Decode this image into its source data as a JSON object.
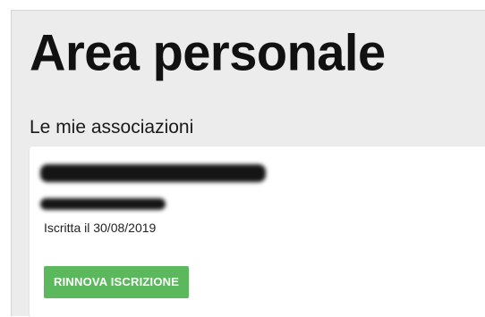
{
  "page": {
    "title": "Area personale",
    "section_title": "Le mie associazioni"
  },
  "association_card": {
    "name_redacted": true,
    "subtitle_redacted": true,
    "joined_text": "Iscritta il 30/08/2019",
    "renew_button_label": "RINNOVA ISCRIZIONE"
  },
  "colors": {
    "background": "#ececec",
    "card": "#ffffff",
    "renew_button": "#5cb85c",
    "title_text": "#111111"
  }
}
